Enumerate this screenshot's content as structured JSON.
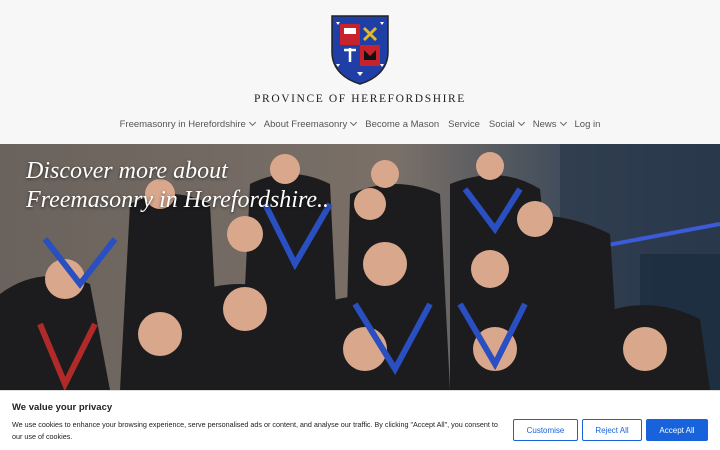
{
  "site": {
    "title": "PROVINCE OF HEREFORDSHIRE"
  },
  "nav": {
    "items": [
      {
        "label": "Freemasonry in Herefordshire",
        "dropdown": true
      },
      {
        "label": "About Freemasonry",
        "dropdown": true
      },
      {
        "label": "Become a Mason",
        "dropdown": false
      },
      {
        "label": "Service",
        "dropdown": false
      },
      {
        "label": "Social",
        "dropdown": true
      },
      {
        "label": "News",
        "dropdown": true
      },
      {
        "label": "Log in",
        "dropdown": false
      }
    ]
  },
  "hero": {
    "line1": "Discover more about",
    "line2": "Freemasonry in Herefordshire.."
  },
  "cookie": {
    "title": "We value your privacy",
    "text": "We use cookies to enhance your browsing experience, serve personalised ads or content, and analyse our traffic. By clicking \"Accept All\", you consent to our use of cookies.",
    "customise": "Customise",
    "reject": "Reject All",
    "accept": "Accept All"
  },
  "colors": {
    "accent": "#1863dc",
    "crest_blue": "#1f3fa6",
    "crest_red": "#c8232c",
    "crest_gold": "#e2b72a"
  },
  "icons": [
    "coat-of-arms-icon",
    "chevron-down-icon"
  ]
}
